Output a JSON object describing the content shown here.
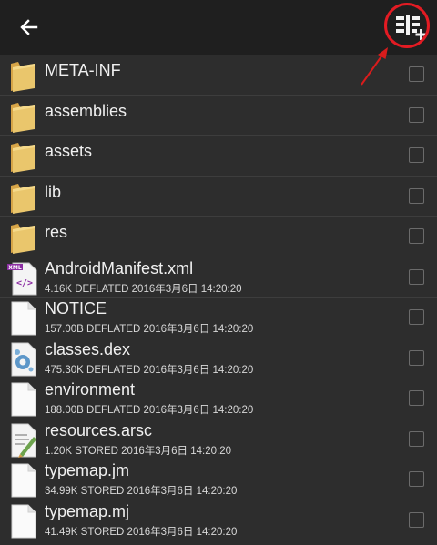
{
  "toolbar": {
    "back_icon": "back-arrow-icon",
    "add_icon": "add-columns-icon"
  },
  "items": [
    {
      "name": "META-INF",
      "type": "folder"
    },
    {
      "name": "assemblies",
      "type": "folder"
    },
    {
      "name": "assets",
      "type": "folder"
    },
    {
      "name": "lib",
      "type": "folder"
    },
    {
      "name": "res",
      "type": "folder"
    },
    {
      "name": "AndroidManifest.xml",
      "type": "file",
      "icon": "xml-file-icon",
      "meta": "4.16K DEFLATED 2016年3月6日 14:20:20"
    },
    {
      "name": "NOTICE",
      "type": "file",
      "icon": "blank-file-icon",
      "meta": "157.00B DEFLATED 2016年3月6日 14:20:20"
    },
    {
      "name": "classes.dex",
      "type": "file",
      "icon": "dex-file-icon",
      "meta": "475.30K DEFLATED 2016年3月6日 14:20:20"
    },
    {
      "name": "environment",
      "type": "file",
      "icon": "blank-file-icon",
      "meta": "188.00B DEFLATED 2016年3月6日 14:20:20"
    },
    {
      "name": "resources.arsc",
      "type": "file",
      "icon": "arsc-file-icon",
      "meta": "1.20K STORED 2016年3月6日 14:20:20"
    },
    {
      "name": "typemap.jm",
      "type": "file",
      "icon": "blank-file-icon",
      "meta": "34.99K STORED 2016年3月6日 14:20:20"
    },
    {
      "name": "typemap.mj",
      "type": "file",
      "icon": "blank-file-icon",
      "meta": "41.49K STORED 2016年3月6日 14:20:20"
    }
  ],
  "colors": {
    "background": "#2d2d2d",
    "toolbar": "#1f1f1f",
    "folder": "#e8c56b",
    "highlight": "#e31b23"
  }
}
